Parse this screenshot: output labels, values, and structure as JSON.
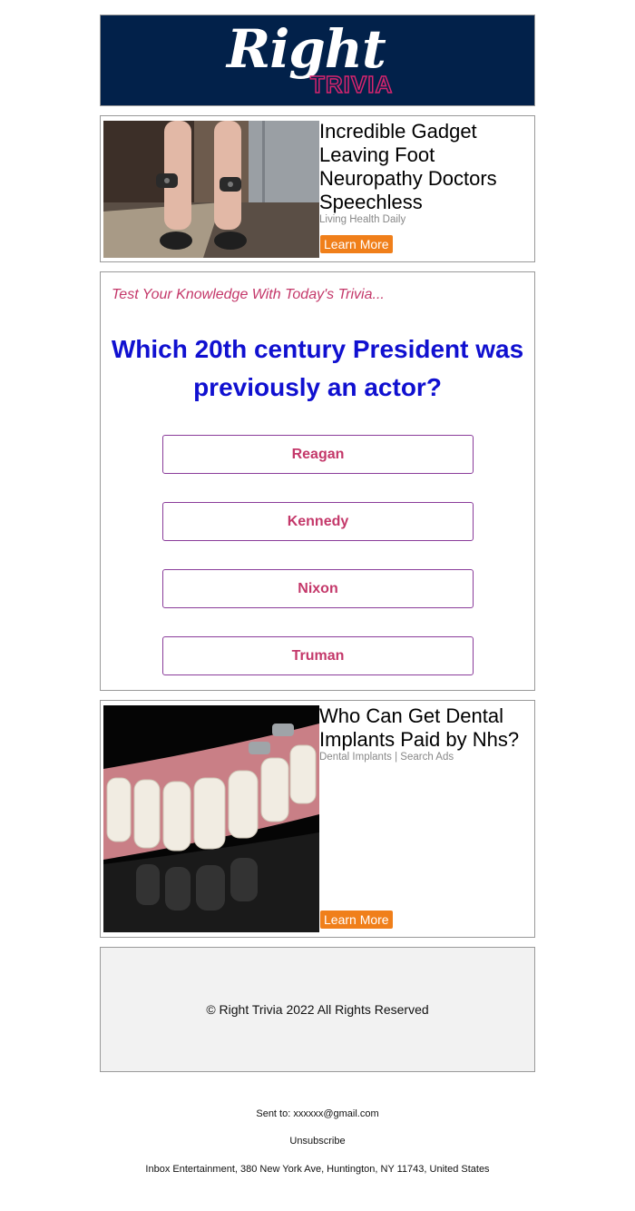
{
  "brand": {
    "logo_word1": "Right",
    "logo_word2": "TRIVIA"
  },
  "ad1": {
    "title": "Incredible Gadget Leaving Foot Neuropathy Doctors Speechless",
    "source": "Living Health Daily",
    "button": "Learn More"
  },
  "quiz": {
    "kicker": "Test Your Knowledge With Today's Trivia...",
    "question": "Which 20th century President was previously an actor?",
    "answers": [
      "Reagan",
      "Kennedy",
      "Nixon",
      "Truman"
    ]
  },
  "ad2": {
    "title": "Who Can Get Dental Implants Paid by Nhs?",
    "source": "Dental Implants | Search Ads",
    "button": "Learn More"
  },
  "footer": {
    "copyright": "© Right Trivia 2022 All Rights Reserved",
    "sent_to": "Sent to: xxxxxx@gmail.com",
    "unsubscribe": "Unsubscribe",
    "address": "Inbox Entertainment, 380 New York Ave, Huntington, NY 11743, United States"
  },
  "colors": {
    "navy": "#02214a",
    "accent": "#c4386a",
    "question": "#1010d0",
    "button": "#f07f1a"
  }
}
